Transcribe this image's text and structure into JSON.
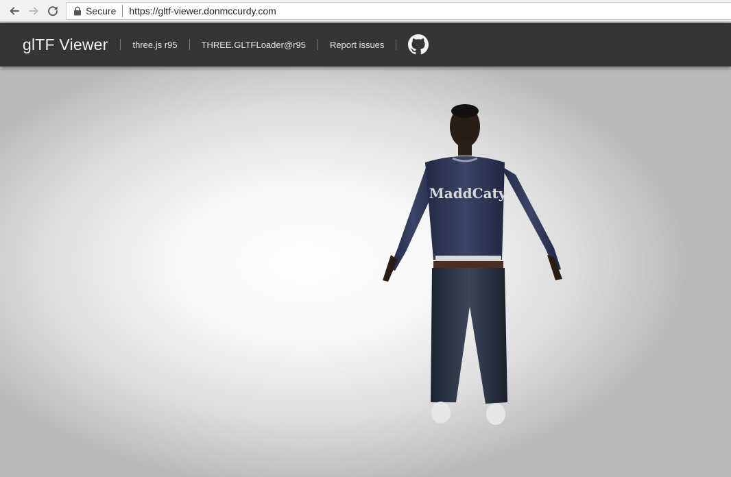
{
  "browser": {
    "secure_label": "Secure",
    "url": "https://gltf-viewer.donmccurdy.com",
    "icons": [
      "back-arrow-icon",
      "forward-arrow-icon",
      "reload-icon",
      "lock-icon"
    ]
  },
  "header": {
    "title": "glTF Viewer",
    "links": [
      {
        "label": "three.js r95"
      },
      {
        "label": "THREE.GLTFLoader@r95"
      },
      {
        "label": "Report issues"
      }
    ],
    "github_icon": "github-icon"
  },
  "viewer": {
    "model_shirt_text": "MaddCaty"
  },
  "colors": {
    "header_bg": "#353535",
    "browser_bg": "#f2f2f2",
    "viewport_center": "#ffffff",
    "viewport_edge": "#b9b9b9"
  }
}
